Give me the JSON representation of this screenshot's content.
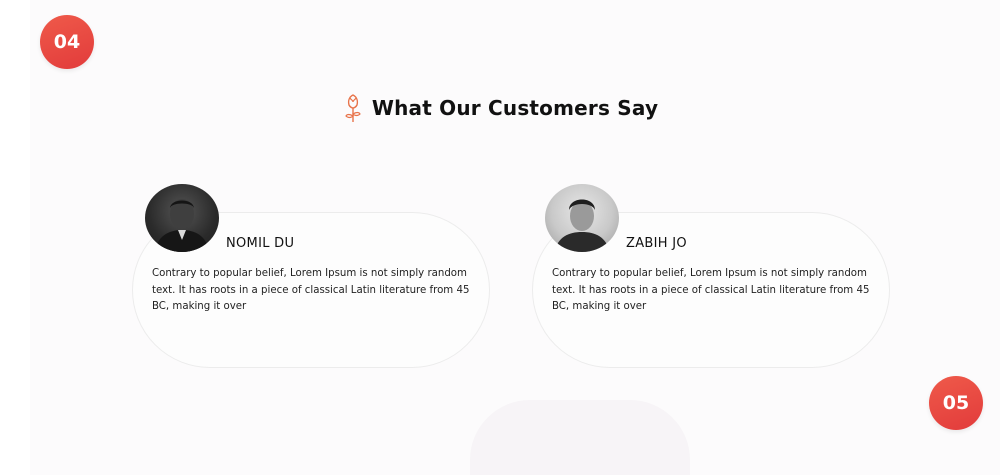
{
  "steps": {
    "badge_a": "04",
    "badge_b": "05"
  },
  "section": {
    "title": "What Our Customers Say",
    "icon": "rose-icon"
  },
  "testimonials": [
    {
      "name": "NOMIL DU",
      "quote": "Contrary to popular belief, Lorem Ipsum is not simply random text. It has roots in a piece of classical Latin literature from 45 BC, making it over",
      "avatar": "man-portrait-dark"
    },
    {
      "name": "ZABIH JO",
      "quote": "Contrary to popular belief, Lorem Ipsum is not simply random text. It has roots in a piece of classical Latin literature from 45 BC, making it over",
      "avatar": "man-portrait-light"
    }
  ],
  "colors": {
    "accent": "#e8473d",
    "icon_stroke": "#e8734a",
    "text": "#111111"
  }
}
